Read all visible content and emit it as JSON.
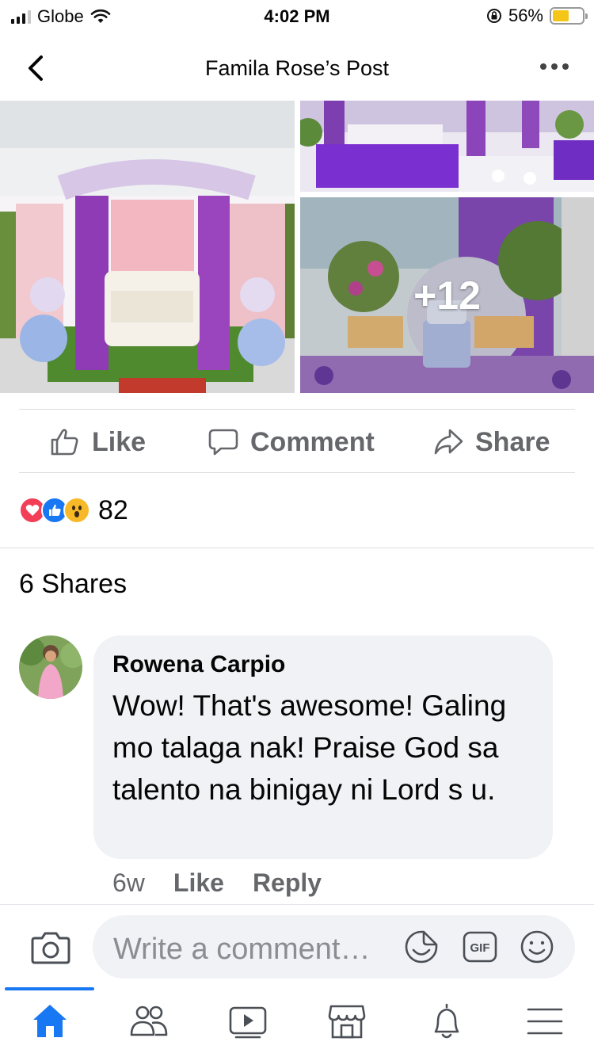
{
  "status_bar": {
    "carrier": "Globe",
    "time": "4:02 PM",
    "battery": "56%",
    "battery_level": 0.56,
    "icons": [
      "signal-icon",
      "wifi-icon",
      "orientation-lock-icon",
      "battery-icon"
    ]
  },
  "header": {
    "title": "Famila Rose’s Post",
    "back_icon": "chevron-left-icon",
    "more_icon": "ellipsis-icon"
  },
  "photos": {
    "more_count": "+12",
    "items": [
      "wedding-stage-photo",
      "reception-tables-photo",
      "dessert-table-photo"
    ]
  },
  "actions": {
    "like": "Like",
    "comment": "Comment",
    "share": "Share"
  },
  "reactions": {
    "types": [
      "love",
      "like",
      "wow"
    ],
    "count": "82"
  },
  "shares": "6 Shares",
  "comment": {
    "author": "Rowena Carpio",
    "text": "Wow! That's awesome! Galing mo talaga nak! Praise God sa talento na binigay ni Lord s u.",
    "time": "6w",
    "like": "Like",
    "reply": "Reply"
  },
  "composer": {
    "placeholder": "Write a comment…",
    "icons": [
      "camera-icon",
      "sticker-icon",
      "gif-icon",
      "emoji-icon"
    ]
  },
  "tabbar": {
    "active": "home",
    "tabs": [
      "home",
      "friends",
      "watch",
      "marketplace",
      "notifications",
      "menu"
    ]
  },
  "colors": {
    "accent": "#1877f2",
    "secondary_text": "#65676b",
    "bubble": "#f0f2f5"
  }
}
